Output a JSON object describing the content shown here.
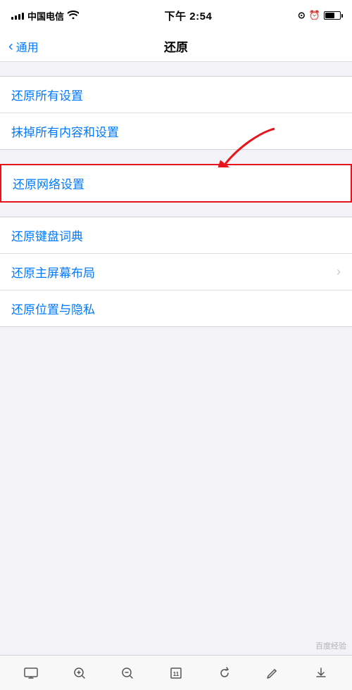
{
  "status": {
    "carrier": "中国电信",
    "wifi": "WiFi",
    "time": "下午 2:54",
    "battery_label": "⬛"
  },
  "nav": {
    "back_label": "通用",
    "title": "还原"
  },
  "group1": {
    "items": [
      {
        "label": "还原所有设置",
        "chevron": false
      },
      {
        "label": "抹掉所有内容和设置",
        "chevron": false
      }
    ]
  },
  "highlighted_item": {
    "label": "还原网络设置"
  },
  "group2": {
    "items": [
      {
        "label": "还原键盘词典",
        "chevron": false
      },
      {
        "label": "还原主屏幕布局",
        "chevron": true
      },
      {
        "label": "还原位置与隐私",
        "chevron": false
      }
    ]
  },
  "toolbar": {
    "monitor_icon": "🖥",
    "zoom_in_icon": "⊕",
    "zoom_out_icon": "⊖",
    "page_icon": "⬛",
    "refresh_icon": "↺",
    "edit_icon": "✏",
    "download_icon": "⬇"
  }
}
